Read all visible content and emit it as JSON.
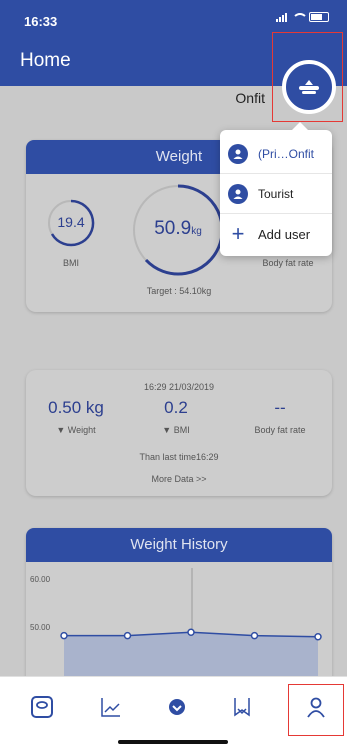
{
  "status_bar": {
    "time": "16:33"
  },
  "header": {
    "title": "Home"
  },
  "profile": {
    "name": "Onfit"
  },
  "popover": {
    "items": [
      {
        "label": "(Pri…Onfit"
      },
      {
        "label": "Tourist"
      },
      {
        "label": "Add user"
      }
    ]
  },
  "weight_card": {
    "title": "Weight",
    "bmi_value": "19.4",
    "bmi_label": "BMI",
    "weight_value": "50.9",
    "weight_unit": "kg",
    "bodyfat_label": "Body fat rate",
    "target": "Target : 54.10kg"
  },
  "stats_card": {
    "timestamp": "16:29 21/03/2019",
    "weight_value": "0.50 kg",
    "weight_label": "Weight",
    "bmi_value": "0.2",
    "bmi_label": "BMI",
    "bodyfat_value": "--",
    "bodyfat_label": "Body fat rate",
    "than_last_time": "Than last time16:29",
    "more_data": "More Data >>"
  },
  "history_card": {
    "title": "Weight History"
  },
  "chart_data": {
    "type": "area",
    "title": "Weight History",
    "ytick_labels": [
      "60.00",
      "50.00"
    ],
    "ylim": [
      40,
      62
    ],
    "points": [
      50.0,
      50.0,
      50.6,
      50.0,
      49.8
    ]
  },
  "tab_bar": {
    "tabs": [
      "scale-icon",
      "trend-icon",
      "home-dot-icon",
      "body-icon",
      "profile-icon"
    ]
  },
  "colors": {
    "primary": "#2f4da3",
    "highlight": "#e53935"
  }
}
